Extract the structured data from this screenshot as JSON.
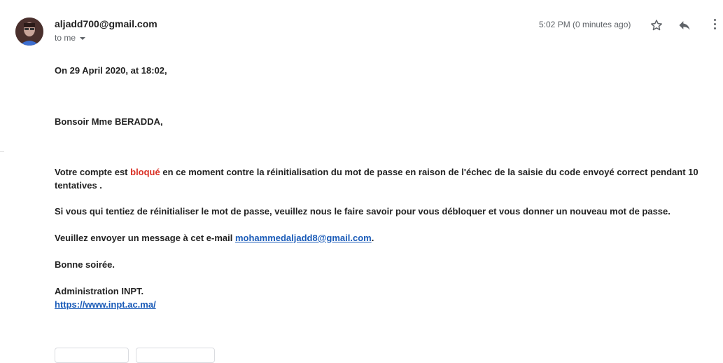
{
  "header": {
    "sender": "aljadd700@gmail.com",
    "recipient": "to me",
    "timestamp": "5:02 PM (0 minutes ago)"
  },
  "icons": {
    "star": "star-icon",
    "reply": "reply-icon",
    "more": "more-vert-icon",
    "caret": "chevron-down-icon"
  },
  "message": {
    "date_line": "On 29 April 2020, at 18:02,",
    "greeting": "Bonsoir Mme BERADDA,",
    "p1_before": "Votre compte est ",
    "p1_red": "bloqué",
    "p1_after": " en ce moment contre la réinitialisation du mot de passe en raison de l'échec de la saisie du code envoyé correct pendant 10 tentatives .",
    "p2": "Si vous qui tentiez de réinitialiser le mot de passe, veuillez nous le faire savoir pour vous débloquer et vous donner un nouveau mot de passe.",
    "p3_before": "Veuillez envoyer un message à cet e-mail ",
    "p3_email": "mohammedaljadd8@gmail.com",
    "p3_after": ".",
    "closing": "Bonne soirée.",
    "signature": "Administration INPT.",
    "signature_link": "https://www.inpt.ac.ma/"
  },
  "colors": {
    "alert_red": "#d93025",
    "link_blue": "#1a5bb8",
    "secondary_text": "#5f6368"
  }
}
